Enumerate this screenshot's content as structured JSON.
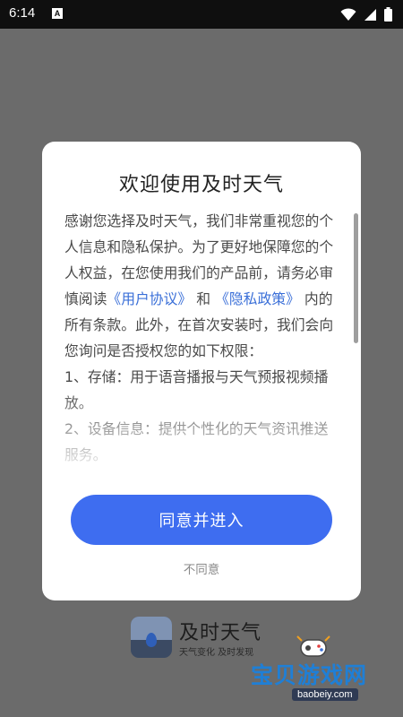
{
  "status_bar": {
    "time": "6:14",
    "notification_badge": "A",
    "icons": [
      "wifi-icon",
      "cellular-icon",
      "battery-icon"
    ]
  },
  "background": {
    "app_title": "及时天气",
    "app_slogan": "天气变化 及时发现"
  },
  "watermark": {
    "title": "宝贝游戏网",
    "url": "baobeiy.com"
  },
  "dialog": {
    "title": "欢迎使用及时天气",
    "intro_before_user_agreement": "感谢您选择及时天气，我们非常重视您的个人信息和隐私保护。为了更好地保障您的个人权益，在您使用我们的产品前，请务必审慎阅读",
    "user_agreement_link": "《用户协议》",
    "and_word": "和",
    "privacy_policy_link": "《隐私政策》",
    "intro_after_links": "内的所有条款。此外，在首次安装时，我们会向您询问是否授权您的如下权限：",
    "permission_1": "1、存储：用于语音播报与天气预报视频播放。",
    "permission_2": "2、设备信息：提供个性化的天气资讯推送服务。",
    "agree_button": "同意并进入",
    "disagree_button": "不同意"
  },
  "colors": {
    "overlay": "#6b6b6b",
    "primary_button": "#3e6df0",
    "link": "#3a6fd8",
    "watermark_title": "#1f7fd6"
  }
}
